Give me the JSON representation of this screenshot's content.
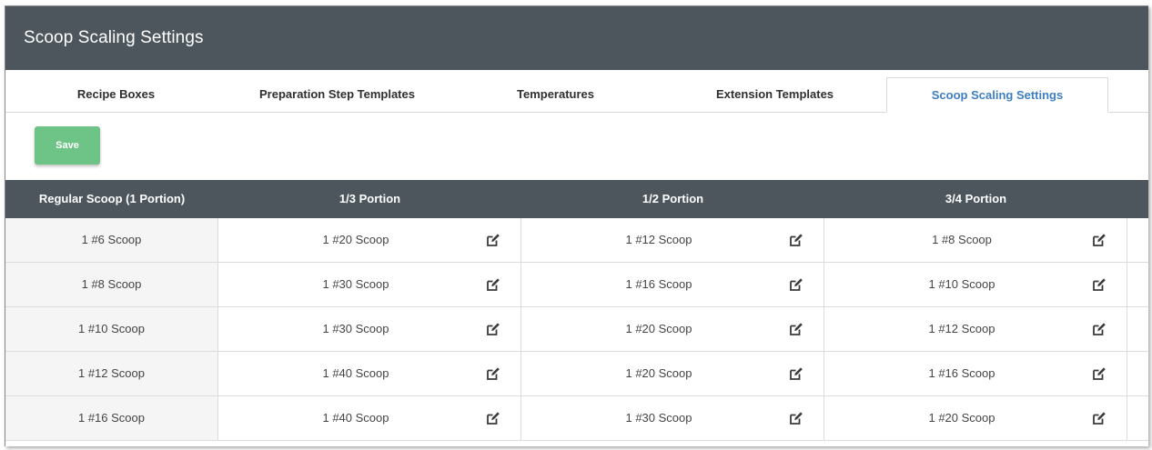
{
  "header": {
    "title": "Scoop Scaling Settings"
  },
  "tabs": [
    {
      "label": "Recipe Boxes"
    },
    {
      "label": "Preparation Step Templates"
    },
    {
      "label": "Temperatures"
    },
    {
      "label": "Extension Templates"
    },
    {
      "label": "Scoop Scaling Settings",
      "active": true
    }
  ],
  "toolbar": {
    "save_label": "Save"
  },
  "colors": {
    "header_bg": "#4d565d",
    "save_green": "#6ec487",
    "active_tab_text": "#3f7fbf"
  },
  "table": {
    "columns": [
      "Regular Scoop (1 Portion)",
      "1/3 Portion",
      "1/2 Portion",
      "3/4 Portion"
    ],
    "rows": [
      [
        "1 #6 Scoop",
        "1 #20 Scoop",
        "1 #12 Scoop",
        "1 #8 Scoop"
      ],
      [
        "1 #8 Scoop",
        "1 #30 Scoop",
        "1 #16 Scoop",
        "1 #10 Scoop"
      ],
      [
        "1 #10 Scoop",
        "1 #30 Scoop",
        "1 #20 Scoop",
        "1 #12 Scoop"
      ],
      [
        "1 #12 Scoop",
        "1 #40 Scoop",
        "1 #20 Scoop",
        "1 #16 Scoop"
      ],
      [
        "1 #16 Scoop",
        "1 #40 Scoop",
        "1 #30 Scoop",
        "1 #20 Scoop"
      ]
    ],
    "edit_icon": "edit-icon"
  }
}
